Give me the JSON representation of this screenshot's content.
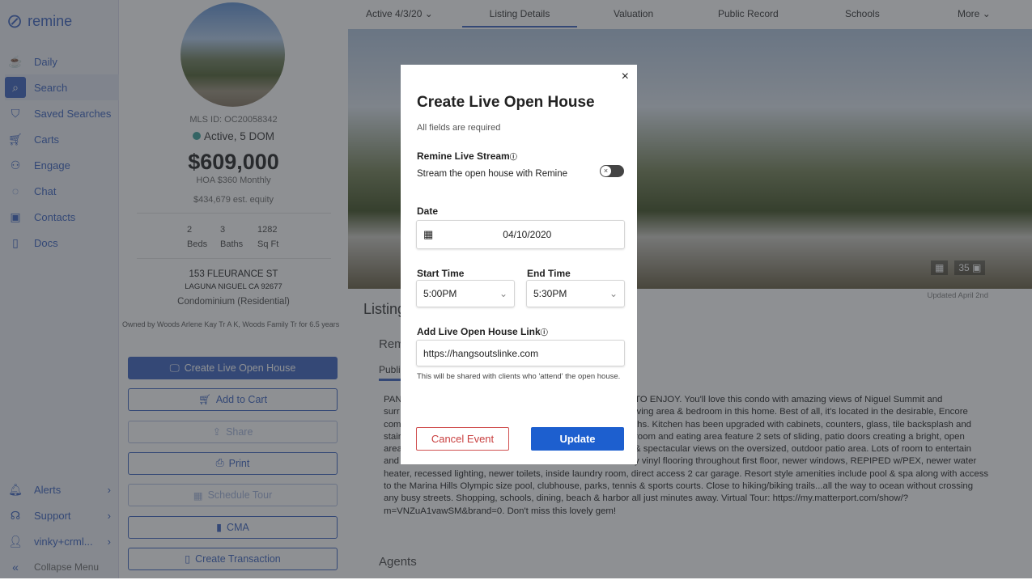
{
  "brand": {
    "name": "remine",
    "accent": "#4a6fc4"
  },
  "sidebar": {
    "items": [
      {
        "label": "Daily",
        "icon": "coffee-icon"
      },
      {
        "label": "Search",
        "icon": "search-icon",
        "active": true
      },
      {
        "label": "Saved Searches",
        "icon": "bookmark-icon"
      },
      {
        "label": "Carts",
        "icon": "cart-icon"
      },
      {
        "label": "Engage",
        "icon": "people-icon"
      },
      {
        "label": "Chat",
        "icon": "chat-icon"
      },
      {
        "label": "Contacts",
        "icon": "contact-card-icon"
      },
      {
        "label": "Docs",
        "icon": "document-icon"
      }
    ],
    "bottom": [
      {
        "label": "Alerts"
      },
      {
        "label": "Support"
      },
      {
        "label": "vinky+crml..."
      },
      {
        "label": "Collapse Menu"
      }
    ]
  },
  "listing": {
    "mls": "MLS ID: OC20058342",
    "status": "Active, 5 DOM",
    "price": "$609,000",
    "hoa": "HOA $360 Monthly",
    "equity": "$434,679 est. equity",
    "stats": [
      {
        "value": "2",
        "label": "Beds"
      },
      {
        "value": "3",
        "label": "Baths"
      },
      {
        "value": "1282",
        "label": "Sq Ft"
      }
    ],
    "street": "153 FLEURANCE ST",
    "city": "LAGUNA NIGUEL CA 92677",
    "type": "Condominium (Residential)",
    "owner": "Owned by Woods Arlene Kay Tr A K, Woods Family Tr for 6.5 years"
  },
  "actions": [
    "Create Live Open House",
    "Add to Cart",
    "Share",
    "Print",
    "Schedule Tour",
    "CMA",
    "Create Transaction"
  ],
  "tabs": [
    "Active 4/3/20",
    "Listing Details",
    "Valuation",
    "Public Record",
    "Schools",
    "More"
  ],
  "hero": {
    "photo_count": "35",
    "updated": "Updated April 2nd"
  },
  "content": {
    "heading": "Listing",
    "remarks": "Rem",
    "subtab": "Publi",
    "agents": "Agents",
    "lines": [
      [
        "PAN",
        "TO ENJOY. You'll love this condo with amazing views of Niguel Summit and"
      ],
      [
        "surr",
        "iving area & bedroom in this home. Best of all, it's located in the desirable, Encore"
      ],
      [
        "com",
        "ths. Kitchen has been upgraded with cabinets, counters, glass, tile backsplash and"
      ],
      [
        "stair",
        "room and eating area feature 2 sets of sliding, patio doors creating a bright, open"
      ],
      [
        "area",
        "& spectacular views on the oversized, outdoor patio area. Lots of room to entertain"
      ],
      [
        "and",
        "y vinyl flooring throughout first floor, newer windows, REPIPED w/PEX, newer water"
      ],
      [
        "heater, recessed lighting, newer toilets, inside laundry room, direct access 2 car garage. Resort style amenities include pool & spa along with access",
        ""
      ],
      [
        "to the Marina Hills Olympic size pool, clubhouse, parks, tennis & sports courts. Close to hiking/biking trails...all the way to ocean without crossing",
        ""
      ],
      [
        "any busy streets. Shopping, schools, dining, beach & harbor all just minutes away. Virtual Tour: https://my.matterport.com/show/?",
        ""
      ],
      [
        "m=VNZuA1vawSM&brand=0. Don't miss this lovely gem!",
        ""
      ]
    ]
  },
  "modal": {
    "title": "Create Live Open House",
    "subtitle": "All fields are required",
    "stream_label": "Remine Live Stream",
    "stream_desc": "Stream the open house with Remine",
    "stream_on": false,
    "date_label": "Date",
    "date": "04/10/2020",
    "start_label": "Start Time",
    "start": "5:00PM",
    "end_label": "End Time",
    "end": "5:30PM",
    "link_label": "Add Live Open House Link",
    "link": "https://hangsoutslinke.com",
    "link_help": "This will be shared with clients who 'attend' the open house.",
    "cancel": "Cancel Event",
    "update": "Update"
  }
}
